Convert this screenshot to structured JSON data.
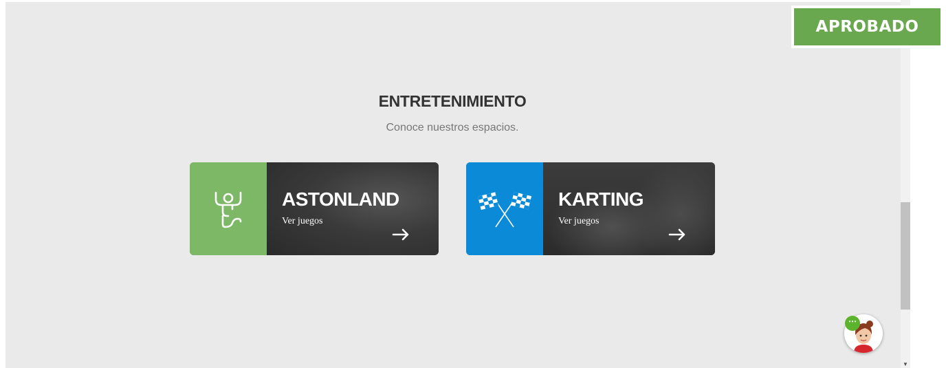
{
  "badge": {
    "label": "APROBADO",
    "color": "#6aa84f"
  },
  "section": {
    "title": "ENTRETENIMIENTO",
    "subtitle": "Conoce nuestros espacios."
  },
  "cards": [
    {
      "title": "ASTONLAND",
      "link_label": "Ver juegos",
      "icon": "kid-playground-icon",
      "color": "#7cb866"
    },
    {
      "title": "KARTING",
      "link_label": "Ver juegos",
      "icon": "checkered-flags-icon",
      "color": "#0b8ad8"
    }
  ],
  "chat": {
    "icon": "chat-bubble-icon",
    "avatar": "assistant-avatar"
  }
}
